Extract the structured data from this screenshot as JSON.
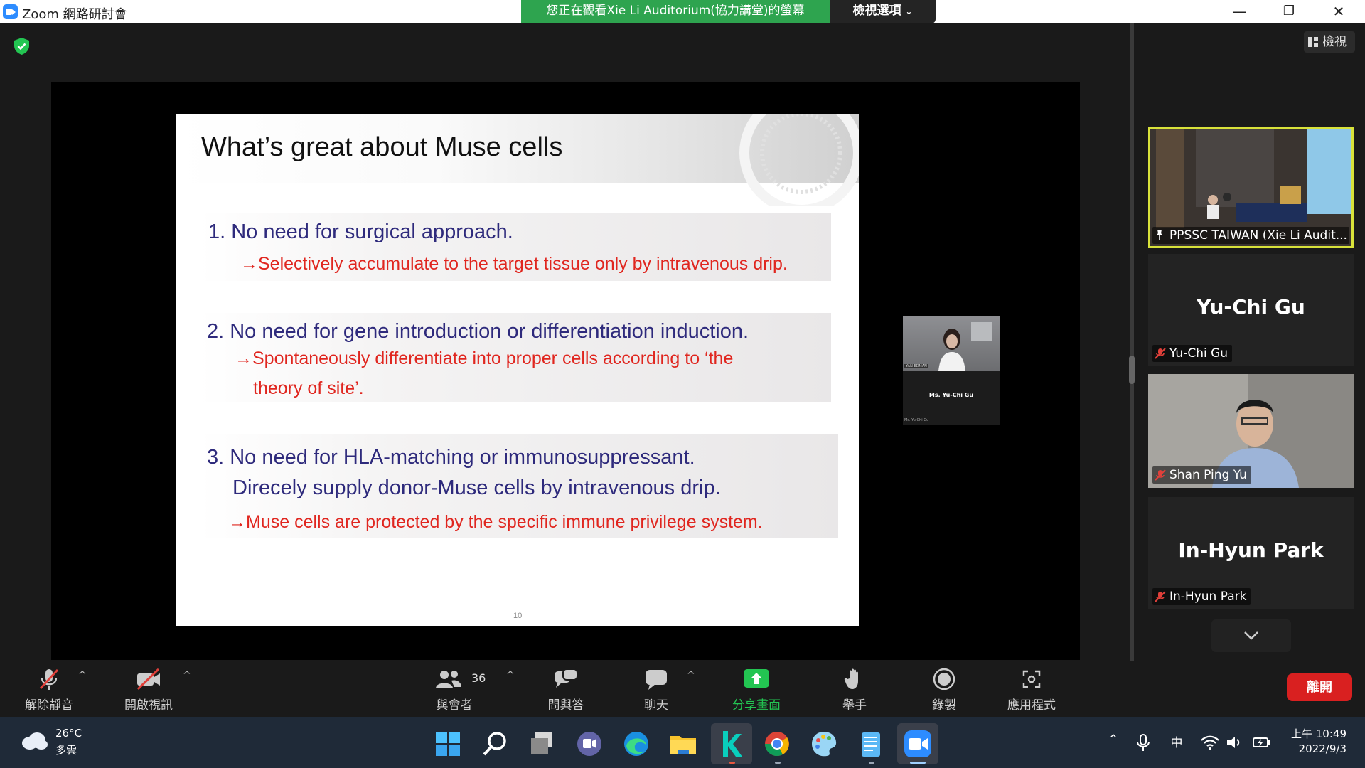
{
  "window": {
    "title": "Zoom 網路研討會",
    "viewing_banner": "您正在觀看Xie Li Auditorium(協力講堂)的螢幕",
    "view_options": "檢視選項",
    "minimize": "—",
    "maximize": "❐",
    "close": "✕"
  },
  "slide": {
    "title": "What’s great about Muse cells",
    "items": [
      {
        "heading": "1.  No need for surgical approach.",
        "note": "→Selectively accumulate to the target tissue only by intravenous drip."
      },
      {
        "heading": "2.  No need for gene introduction or differentiation induction.",
        "note_1": "→Spontaneously differentiate into proper cells according to ‘the",
        "note_2": "theory of site’."
      },
      {
        "heading": "3.  No need for HLA-matching or immunosuppressant.",
        "heading_2": "Direcely supply donor-Muse cells by intravenous drip.",
        "note": "→Muse cells are protected by the specific immune privilege system."
      }
    ],
    "page_number": "10"
  },
  "speaker_pip": {
    "name": "Ms. Yu-Chi Gu",
    "label": "YAN EDMAN",
    "tag": "Ms. Yu-Chi Gu"
  },
  "panel": {
    "view_label": "檢視",
    "participants": [
      {
        "tag": "PPSSC TAIWAN (Xie Li Audit..."
      },
      {
        "big_name": "Yu-Chi Gu",
        "tag": "Yu-Chi Gu"
      },
      {
        "tag": "Shan Ping Yu"
      },
      {
        "big_name": "In-Hyun Park",
        "tag": "In-Hyun Park"
      }
    ]
  },
  "toolbar": {
    "unmute": "解除靜音",
    "start_video": "開啟視訊",
    "participants": "與會者",
    "participants_count": "36",
    "qa": "問與答",
    "chat": "聊天",
    "share": "分享畫面",
    "raise_hand": "舉手",
    "record": "錄製",
    "apps": "應用程式",
    "leave": "離開",
    "caret": "^"
  },
  "taskbar": {
    "temperature": "26°C",
    "condition": "多雲",
    "ime": "中",
    "time": "上午 10:49",
    "date": "2022/9/3"
  },
  "colors": {
    "zoom_blue": "#2D8CFF",
    "banner_green": "#2ea44f",
    "leave_red": "#d92020",
    "pin_border": "#d8e23a",
    "slide_blue": "#2e2a7c",
    "slide_red": "#e0261f"
  }
}
